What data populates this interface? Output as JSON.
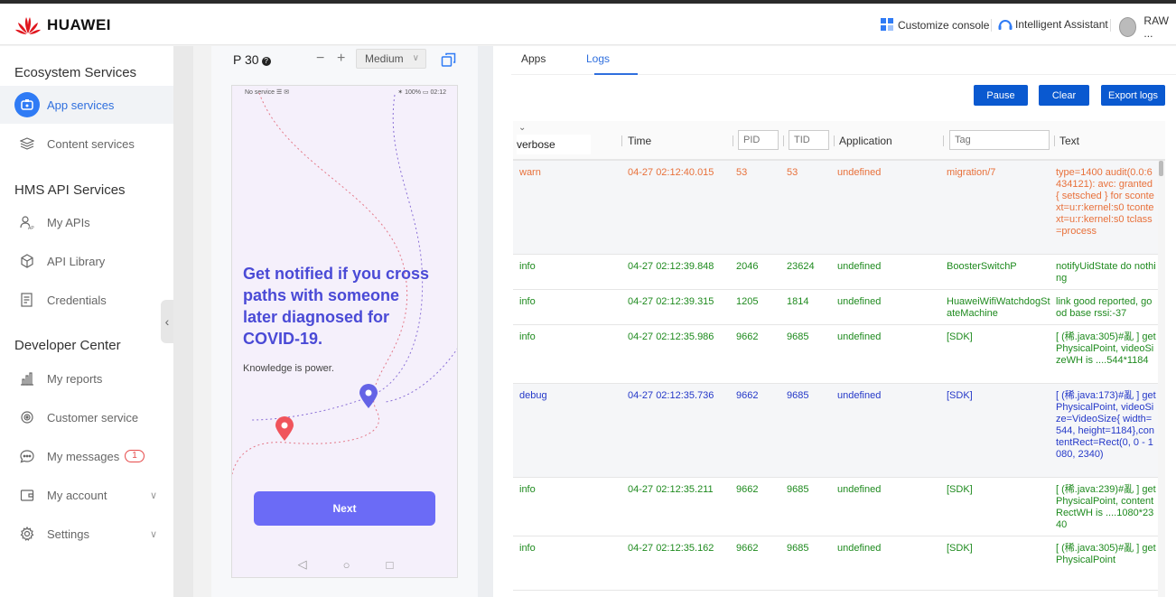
{
  "header": {
    "brand": "HUAWEI",
    "customize": "Customize console",
    "assistant": "Intelligent Assistant",
    "user": "RAW ..."
  },
  "sidebar": {
    "sections": [
      "Ecosystem Services",
      "HMS API Services",
      "Developer Center"
    ],
    "items": [
      {
        "label": "App services",
        "icon": "app-services-icon"
      },
      {
        "label": "Content services",
        "icon": "layers-icon"
      },
      {
        "label": "My APIs",
        "icon": "user-api-icon"
      },
      {
        "label": "API Library",
        "icon": "cube-icon"
      },
      {
        "label": "Credentials",
        "icon": "document-icon"
      },
      {
        "label": "My reports",
        "icon": "bar-chart-icon"
      },
      {
        "label": "Customer service",
        "icon": "headset-icon"
      },
      {
        "label": "My messages",
        "icon": "chat-icon",
        "badge": "1"
      },
      {
        "label": "My account",
        "icon": "wallet-icon"
      },
      {
        "label": "Settings",
        "icon": "gear-icon"
      }
    ]
  },
  "phone_panel": {
    "device": "P 30",
    "zoom_out": "−",
    "zoom_in": "+",
    "size": "Medium",
    "statusbar_left": "No service ☰ ✉",
    "statusbar_right": "✶ 100% ▭ 02:12",
    "title": "Get notified if you cross paths with someone later diagnosed for COVID-19.",
    "subtitle": "Knowledge is power.",
    "next": "Next",
    "nav": [
      "◁",
      "○",
      "□"
    ]
  },
  "logs": {
    "tabs": [
      "Apps",
      "Logs"
    ],
    "buttons": {
      "pause": "Pause",
      "clear": "Clear",
      "export": "Export logs"
    },
    "level": "verbose",
    "columns": {
      "time": "Time",
      "application": "Application",
      "text": "Text"
    },
    "placeholders": {
      "pid": "PID",
      "tid": "TID",
      "tag": "Tag"
    },
    "rows": [
      {
        "level": "warn",
        "time": "04-27 02:12:40.015",
        "pid": "53",
        "tid": "53",
        "app": "undefined",
        "tag": "migration/7",
        "text": "type=1400 audit(0.0:6434121): avc: granted { setsched } for scontext=u:r:kernel:s0 tcontext=u:r:kernel:s0 tclass=process"
      },
      {
        "level": "info",
        "time": "04-27 02:12:39.848",
        "pid": "2046",
        "tid": "23624",
        "app": "undefined",
        "tag": "BoosterSwitchP",
        "text": "notifyUidState do nothing"
      },
      {
        "level": "info",
        "time": "04-27 02:12:39.315",
        "pid": "1205",
        "tid": "1814",
        "app": "undefined",
        "tag": "HuaweiWifiWatchdogStateMachine",
        "text": "link good reported, good base rssi:-37"
      },
      {
        "level": "info",
        "time": "04-27 02:12:35.986",
        "pid": "9662",
        "tid": "9685",
        "app": "undefined",
        "tag": "[SDK]",
        "text": "[ (稀.java:305)#亂 ] getPhysicalPoint, videoSizeWH is ....544*1184"
      },
      {
        "level": "debug",
        "time": "04-27 02:12:35.736",
        "pid": "9662",
        "tid": "9685",
        "app": "undefined",
        "tag": "[SDK]",
        "text": "[ (稀.java:173)#亂 ] getPhysicalPoint, videoSize=VideoSize{ width=544, height=1184},contentRect=Rect(0, 0 - 1080, 2340)"
      },
      {
        "level": "info",
        "time": "04-27 02:12:35.211",
        "pid": "9662",
        "tid": "9685",
        "app": "undefined",
        "tag": "[SDK]",
        "text": "[ (稀.java:239)#亂 ] getPhysicalPoint, contentRectWH is ....1080*2340"
      },
      {
        "level": "info",
        "time": "04-27 02:12:35.162",
        "pid": "9662",
        "tid": "9685",
        "app": "undefined",
        "tag": "[SDK]",
        "text": "[ (稀.java:305)#亂 ] getPhysicalPoint"
      }
    ]
  },
  "colors": {
    "warn": "#e8703a",
    "info": "#1e8a1e",
    "debug": "#2438c8",
    "accent": "#2f6fde",
    "button": "#0a59d0"
  }
}
